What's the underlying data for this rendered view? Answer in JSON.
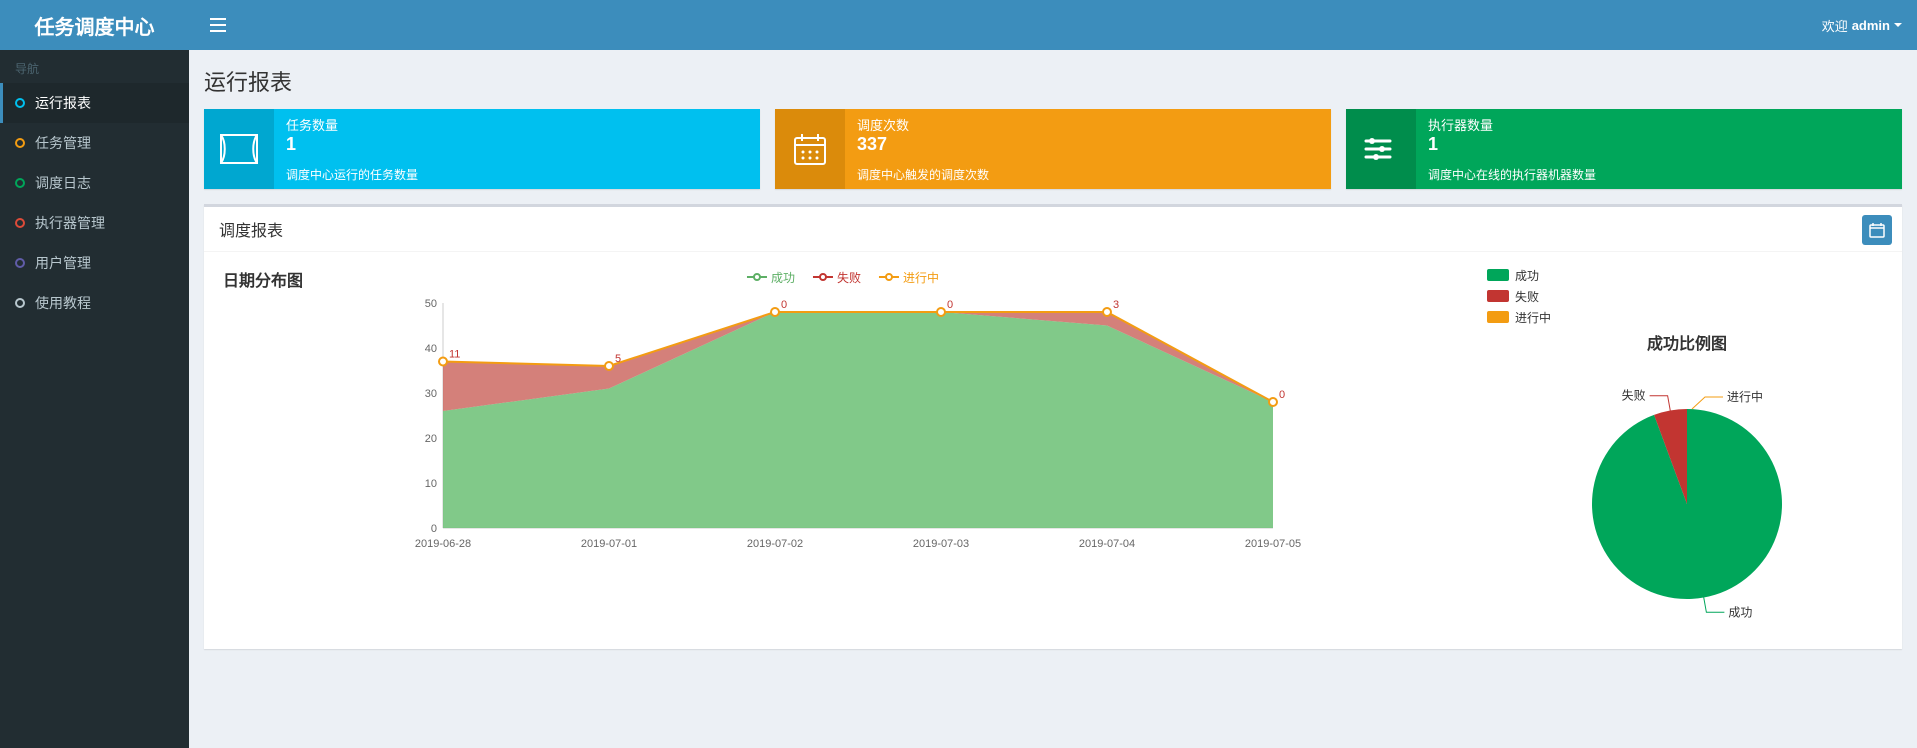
{
  "app": {
    "title": "任务调度中心"
  },
  "header": {
    "welcome_prefix": "欢迎",
    "username": "admin"
  },
  "sidebar": {
    "nav_header": "导航",
    "items": [
      {
        "label": "运行报表",
        "color": "#00c0ef",
        "active": true
      },
      {
        "label": "任务管理",
        "color": "#f39c12",
        "active": false
      },
      {
        "label": "调度日志",
        "color": "#00a65a",
        "active": false
      },
      {
        "label": "执行器管理",
        "color": "#dd4b39",
        "active": false
      },
      {
        "label": "用户管理",
        "color": "#605ca8",
        "active": false
      },
      {
        "label": "使用教程",
        "color": "#b8c7ce",
        "active": false
      }
    ]
  },
  "page": {
    "title": "运行报表"
  },
  "info_boxes": [
    {
      "label": "任务数量",
      "value": "1",
      "desc": "调度中心运行的任务数量",
      "color": "aqua"
    },
    {
      "label": "调度次数",
      "value": "337",
      "desc": "调度中心触发的调度次数",
      "color": "yellow"
    },
    {
      "label": "执行器数量",
      "value": "1",
      "desc": "调度中心在线的执行器机器数量",
      "color": "green"
    }
  ],
  "panel": {
    "title": "调度报表"
  },
  "colors": {
    "success": "#5daf65",
    "success_fill": "#6bbf74",
    "fail": "#c23531",
    "fail_fill": "#cc6a63",
    "running": "#f39c12"
  },
  "chart_data": [
    {
      "type": "area",
      "title": "日期分布图",
      "legend": [
        "成功",
        "失败",
        "进行中"
      ],
      "categories": [
        "2019-06-28",
        "2019-07-01",
        "2019-07-02",
        "2019-07-03",
        "2019-07-04",
        "2019-07-05"
      ],
      "ylim": [
        0,
        50
      ],
      "yticks": [
        0,
        10,
        20,
        30,
        40,
        50
      ],
      "series": [
        {
          "name": "成功",
          "values": [
            26,
            31,
            48,
            48,
            45,
            28
          ]
        },
        {
          "name": "失败",
          "values": [
            11,
            5,
            0,
            0,
            3,
            0
          ]
        },
        {
          "name": "进行中",
          "values": [
            0,
            0,
            0,
            0,
            0,
            0
          ]
        }
      ],
      "labels_top_stack": [
        37,
        36,
        48,
        48,
        48,
        28
      ],
      "labels_fail_layer": [
        "11",
        "5",
        "0",
        "0",
        "3",
        "0"
      ]
    },
    {
      "type": "pie",
      "title": "成功比例图",
      "series": [
        {
          "name": "成功",
          "value": 318,
          "color": "#00a65a"
        },
        {
          "name": "失败",
          "value": 19,
          "color": "#c23531"
        },
        {
          "name": "进行中",
          "value": 0,
          "color": "#f39c12"
        }
      ]
    }
  ]
}
